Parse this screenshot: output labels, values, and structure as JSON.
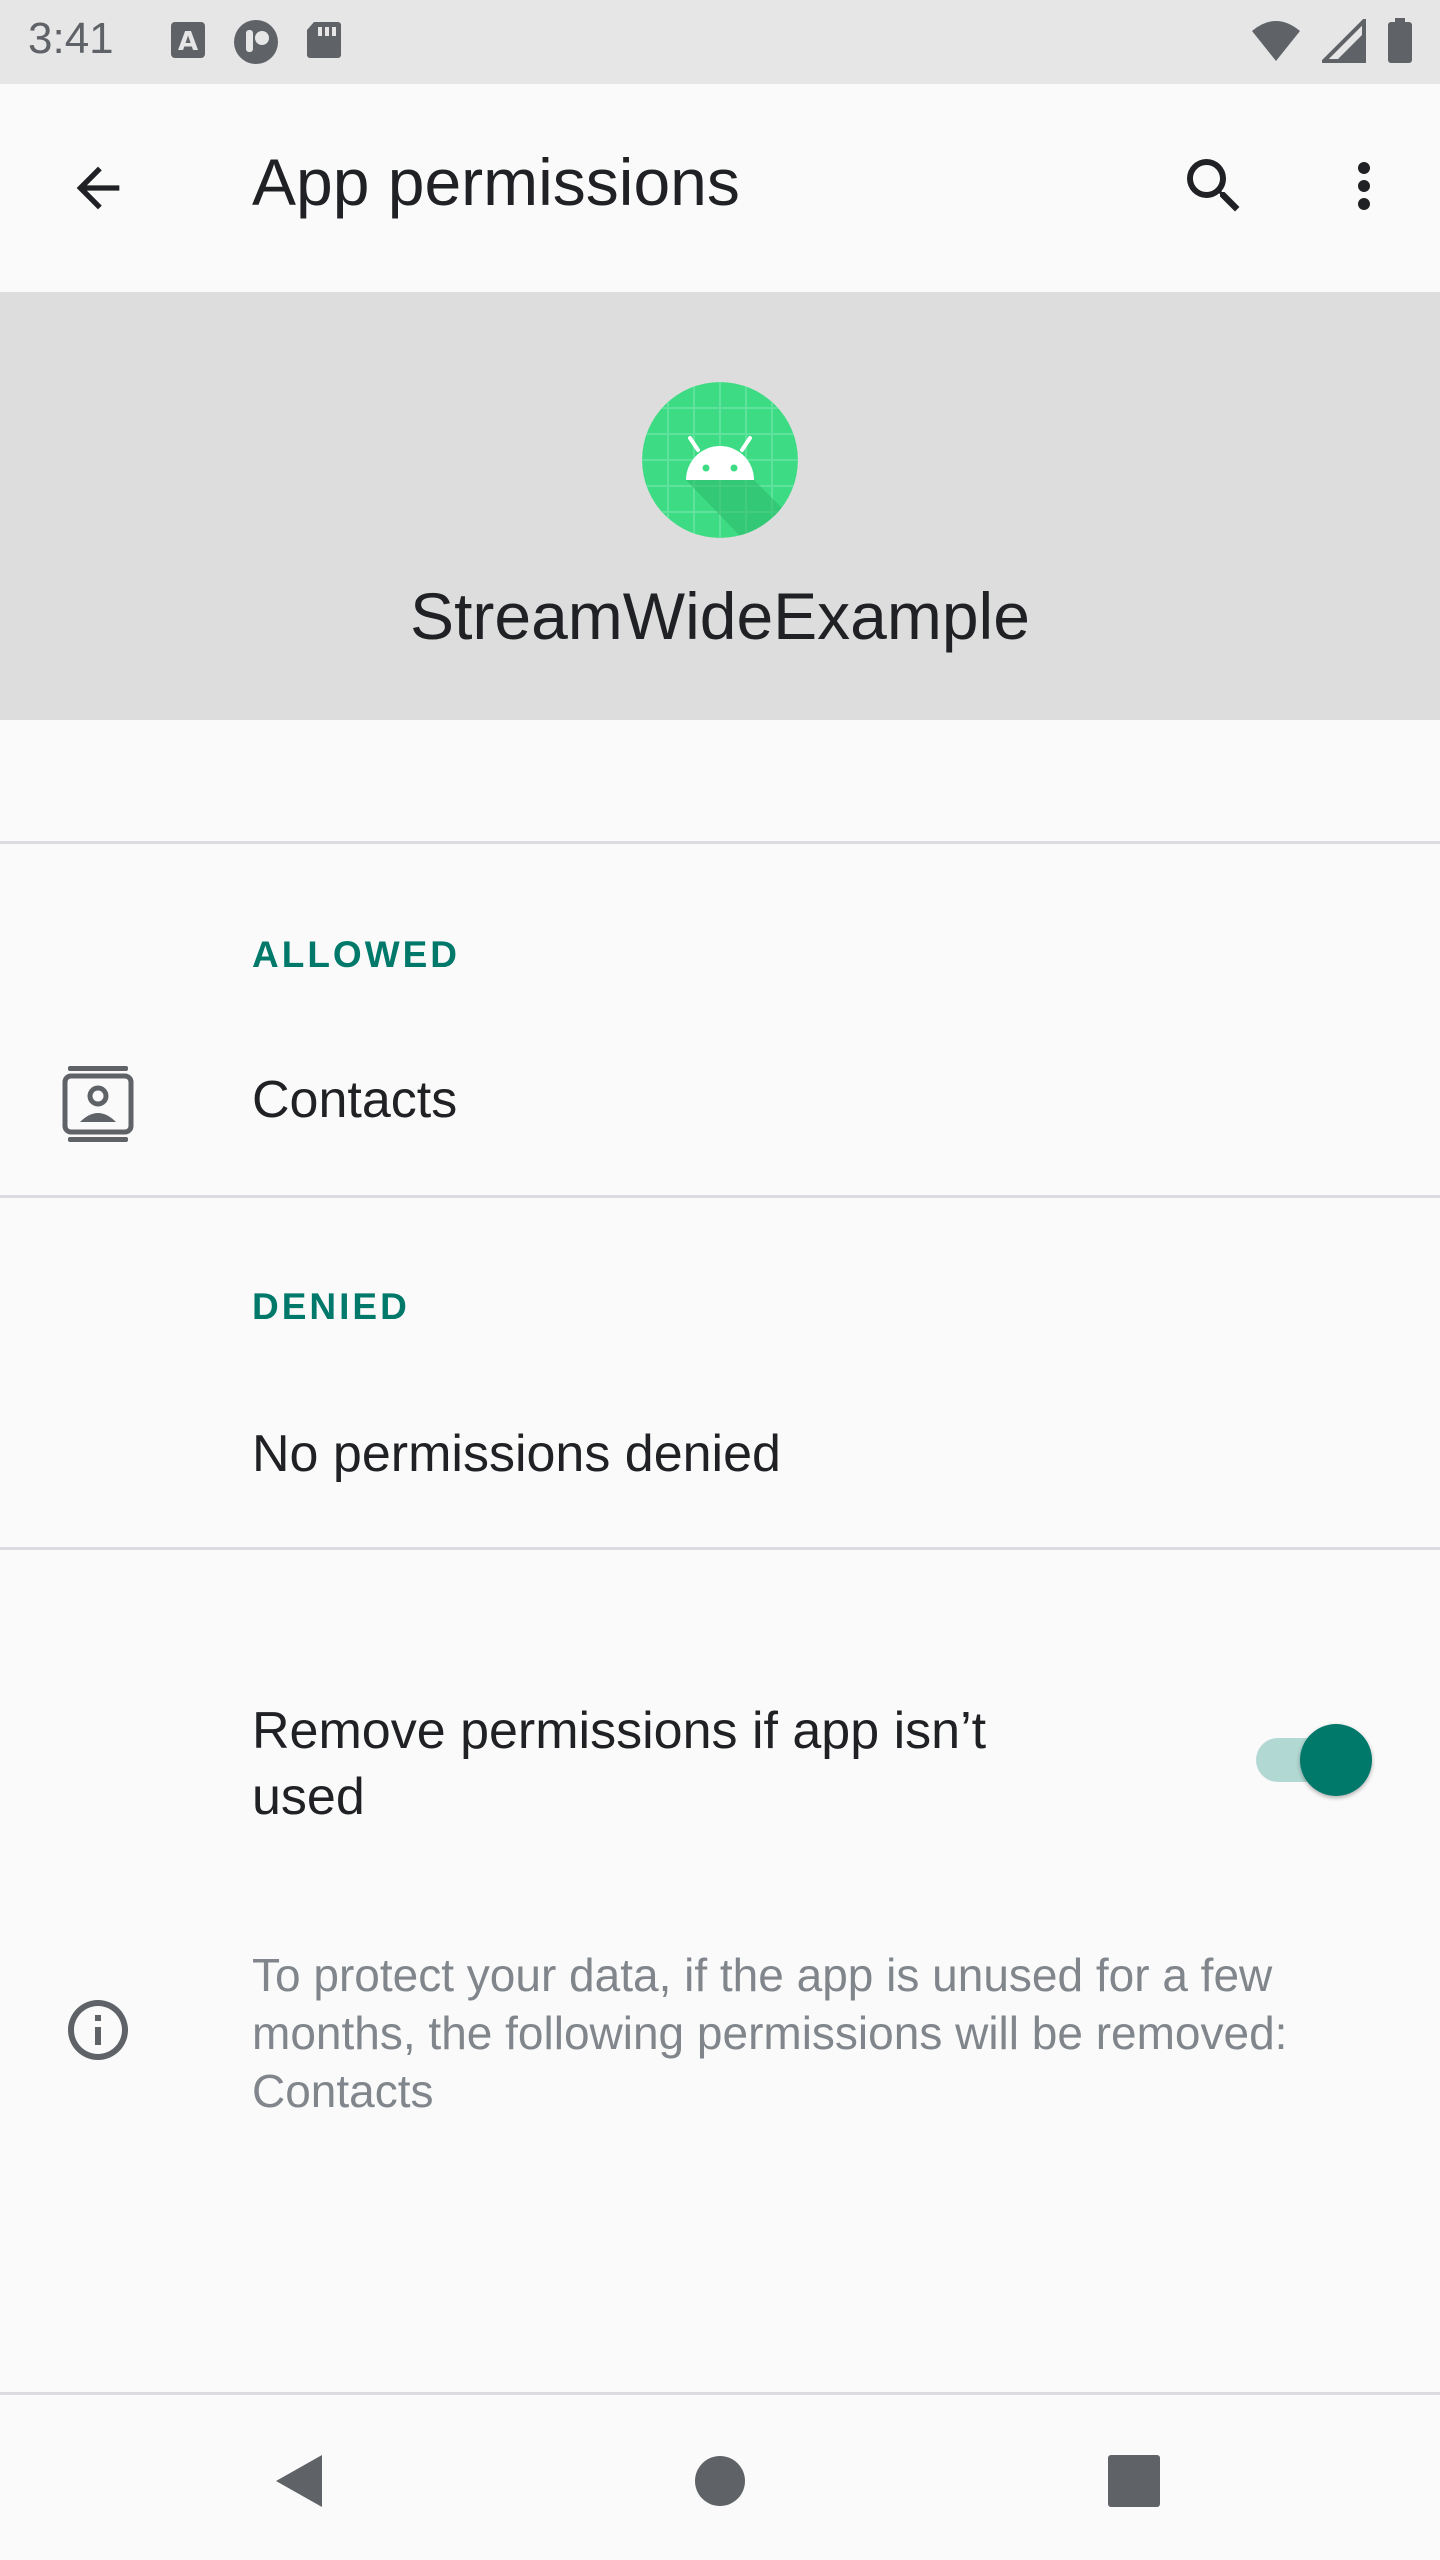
{
  "status_bar": {
    "time": "3:41",
    "left_icons": [
      "a-box-icon",
      "sim-toolkit-icon",
      "sd-card-icon"
    ],
    "right_icons": [
      "wifi-icon",
      "signal-icon",
      "battery-icon"
    ]
  },
  "app_bar": {
    "title": "App permissions",
    "back_icon": "arrow-back-icon",
    "search_icon": "search-icon",
    "more_icon": "more-vert-icon"
  },
  "app_header": {
    "app_name": "StreamWideExample",
    "icon": "android-icon"
  },
  "sections": {
    "allowed": {
      "label": "ALLOWED",
      "items": [
        {
          "label": "Contacts",
          "icon": "contacts-icon"
        }
      ]
    },
    "denied": {
      "label": "DENIED",
      "empty_text": "No permissions denied"
    }
  },
  "auto_revoke": {
    "label": "Remove permissions if app isn’t used",
    "enabled": true
  },
  "info": {
    "text": "To protect your data, if the app is unused for a few months, the following permissions will be removed: Contacts",
    "icon": "info-icon"
  },
  "nav_bar": {
    "back": "nav-back-icon",
    "home": "nav-home-icon",
    "recents": "nav-recents-icon"
  },
  "colors": {
    "accent": "#00796b",
    "toggle_track": "#b2d8d3",
    "header_band": "#dddddd",
    "background": "#fafafa"
  }
}
